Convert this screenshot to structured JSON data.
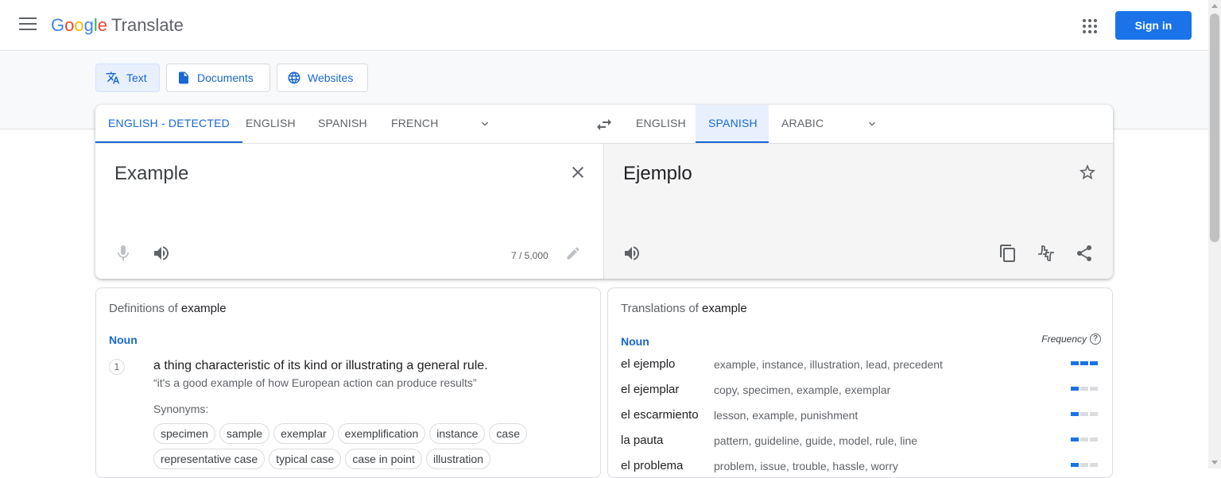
{
  "header": {
    "logo_google": [
      "G",
      "o",
      "o",
      "g",
      "l",
      "e"
    ],
    "logo_product": "Translate",
    "signin_label": "Sign in"
  },
  "modes": [
    {
      "label": "Text",
      "icon": "translate-icon",
      "active": true
    },
    {
      "label": "Documents",
      "icon": "document-icon",
      "active": false
    },
    {
      "label": "Websites",
      "icon": "globe-icon",
      "active": false
    }
  ],
  "source_tabs": [
    "ENGLISH - DETECTED",
    "ENGLISH",
    "SPANISH",
    "FRENCH"
  ],
  "target_tabs": [
    "ENGLISH",
    "SPANISH",
    "ARABIC"
  ],
  "source": {
    "text": "Example",
    "char_count": "7 / 5,000"
  },
  "target": {
    "text": "Ejemplo"
  },
  "definitions": {
    "title_prefix": "Definitions of",
    "word": "example",
    "pos": "Noun",
    "items": [
      {
        "number": "1",
        "definition": "a thing characteristic of its kind or illustrating a general rule.",
        "example": "“it's a good example of how European action can produce results”",
        "synonyms_label": "Synonyms:",
        "synonyms": [
          "specimen",
          "sample",
          "exemplar",
          "exemplification",
          "instance",
          "case",
          "representative case",
          "typical case",
          "case in point",
          "illustration"
        ]
      }
    ]
  },
  "translations": {
    "title_prefix": "Translations of",
    "word": "example",
    "pos": "Noun",
    "frequency_label": "Frequency",
    "rows": [
      {
        "word": "el ejemplo",
        "synonyms": "example, instance, illustration, lead, precedent",
        "frequency": 3
      },
      {
        "word": "el ejemplar",
        "synonyms": "copy, specimen, example, exemplar",
        "frequency": 1
      },
      {
        "word": "el escarmiento",
        "synonyms": "lesson, example, punishment",
        "frequency": 1
      },
      {
        "word": "la pauta",
        "synonyms": "pattern, guideline, guide, model, rule, line",
        "frequency": 1
      },
      {
        "word": "el problema",
        "synonyms": "problem, issue, trouble, hassle, worry",
        "frequency": 1
      }
    ]
  },
  "colors": {
    "accent": "#1a73e8",
    "accent_text": "#1967d2"
  }
}
